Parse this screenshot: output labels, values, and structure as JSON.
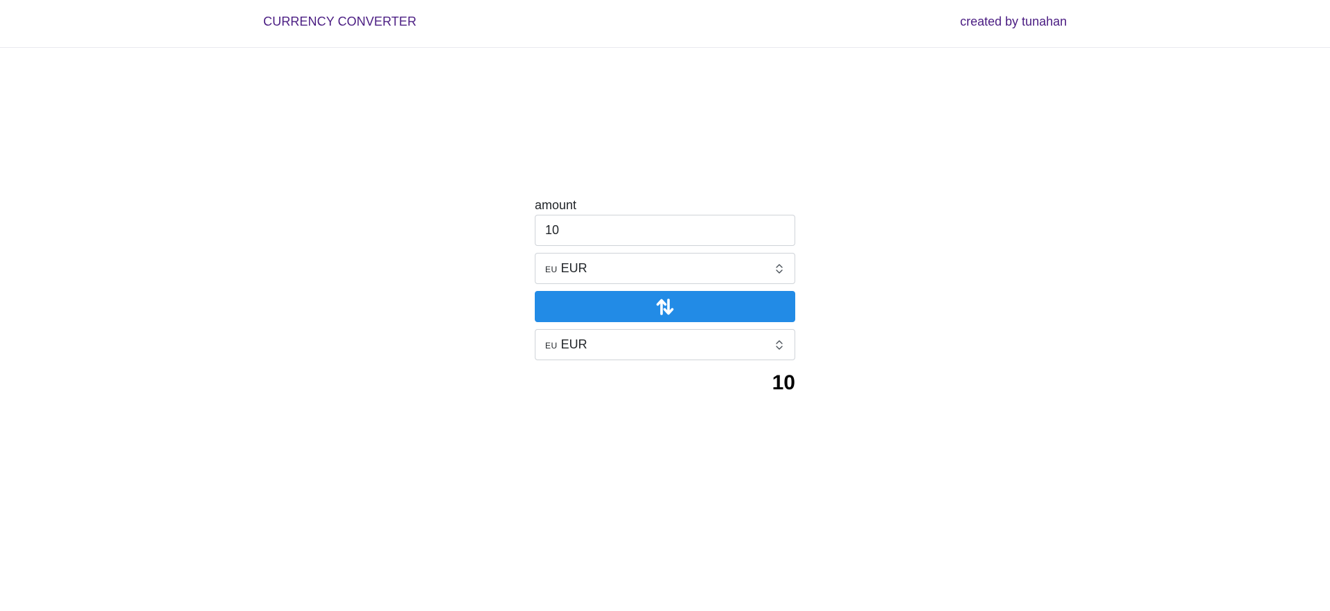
{
  "header": {
    "brand": "CURRENCY CONVERTER",
    "credit": "created by tunahan"
  },
  "converter": {
    "amount_label": "amount",
    "amount_value": "10",
    "from": {
      "flag": "EU",
      "code": "EUR"
    },
    "to": {
      "flag": "EU",
      "code": "EUR"
    },
    "swap_icon": "swap-vertical-arrows",
    "result": "10"
  },
  "colors": {
    "brand_text": "#4a1c82",
    "button_blue": "#228be6"
  }
}
